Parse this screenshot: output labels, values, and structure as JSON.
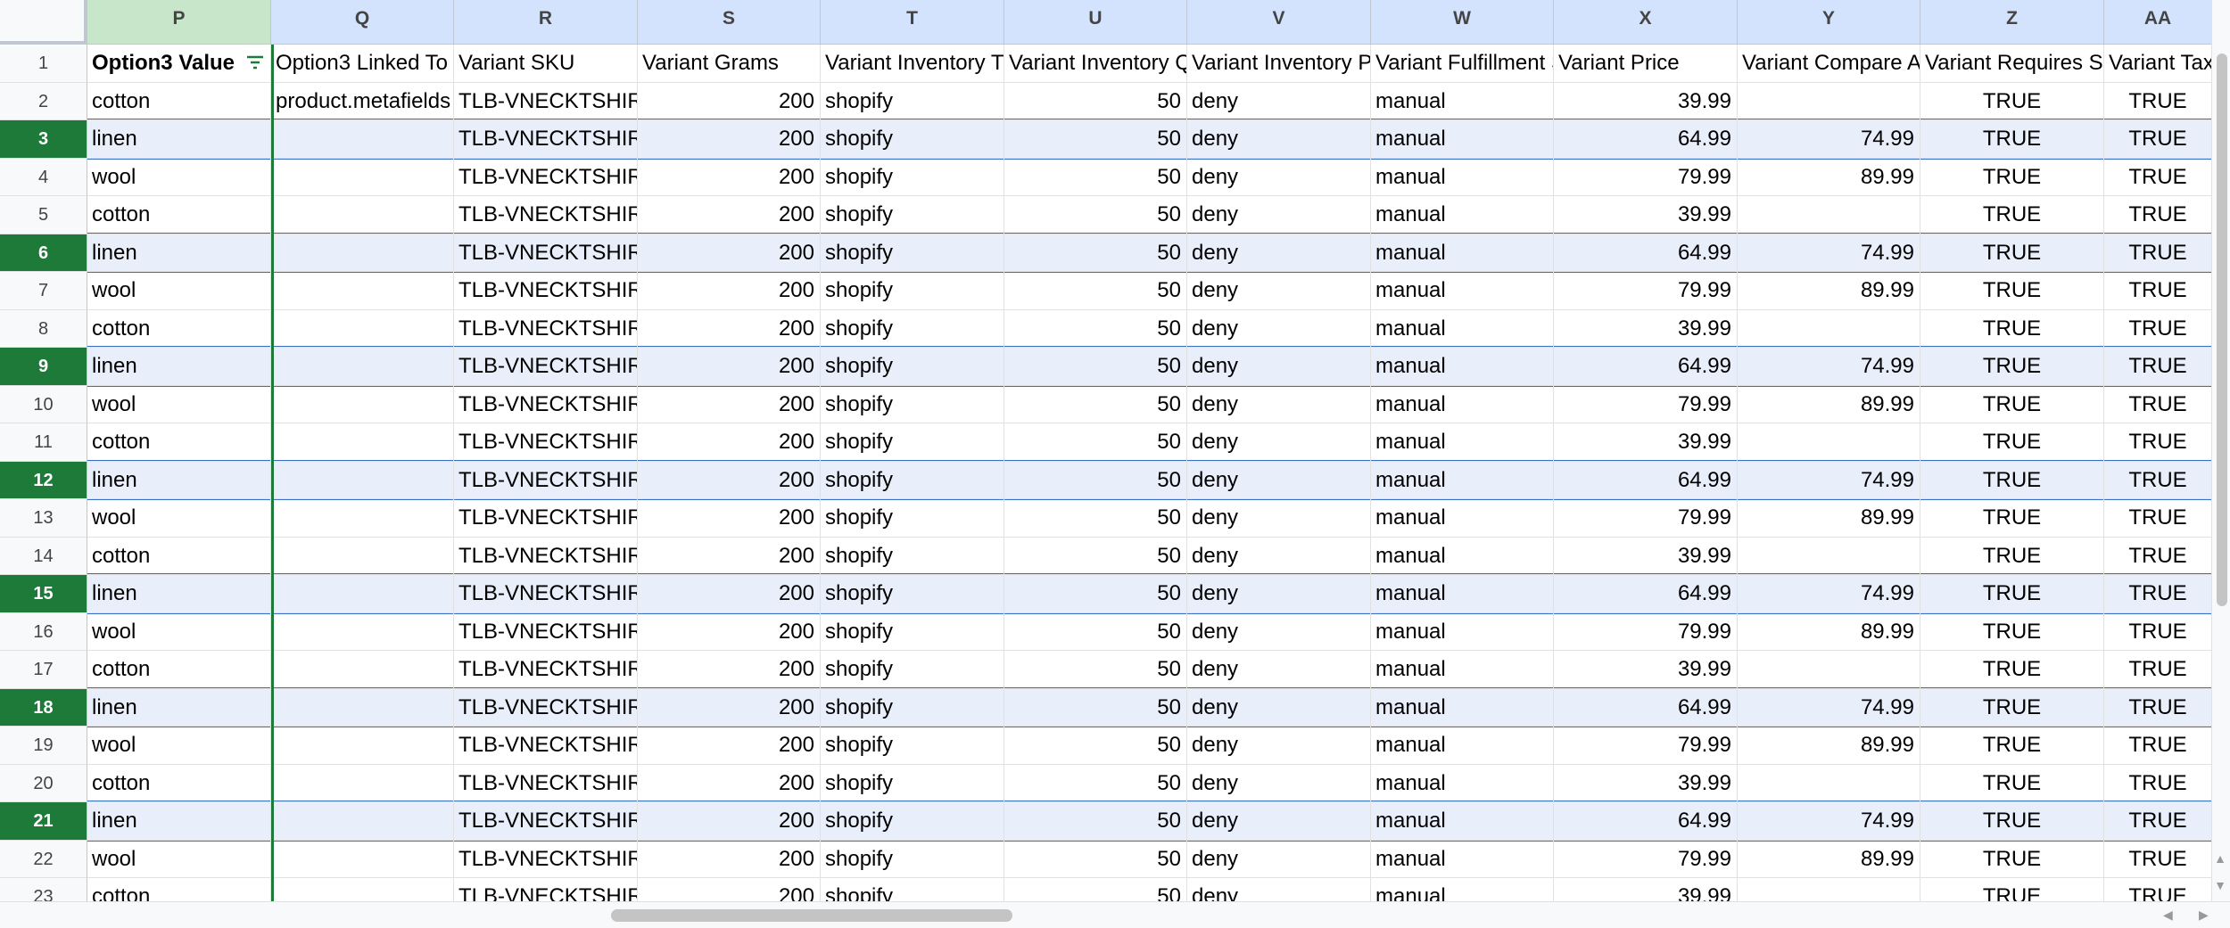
{
  "columns": [
    {
      "letter": "P",
      "header": "Option3 Value",
      "bold": true,
      "filter": true
    },
    {
      "letter": "Q",
      "header": "Option3 Linked To"
    },
    {
      "letter": "R",
      "header": "Variant SKU"
    },
    {
      "letter": "S",
      "header": "Variant Grams"
    },
    {
      "letter": "T",
      "header": "Variant Inventory Tracker"
    },
    {
      "letter": "U",
      "header": "Variant Inventory Qty"
    },
    {
      "letter": "V",
      "header": "Variant Inventory Policy"
    },
    {
      "letter": "W",
      "header": "Variant Fulfillment Service"
    },
    {
      "letter": "X",
      "header": "Variant Price"
    },
    {
      "letter": "Y",
      "header": "Variant Compare At Price"
    },
    {
      "letter": "Z",
      "header": "Variant Requires Shipping"
    },
    {
      "letter": "AA",
      "header": "Variant Taxable"
    }
  ],
  "rows": [
    {
      "num": "2",
      "cells": [
        "cotton",
        "product.metafields",
        "TLB-VNECKTSHIRT",
        "200",
        "shopify",
        "50",
        "deny",
        "manual",
        "39.99",
        "",
        "TRUE",
        "TRUE"
      ]
    },
    {
      "num": "3",
      "cells": [
        "linen",
        "",
        "TLB-VNECKTSHIRT",
        "200",
        "shopify",
        "50",
        "deny",
        "manual",
        "64.99",
        "74.99",
        "TRUE",
        "TRUE"
      ]
    },
    {
      "num": "4",
      "cells": [
        "wool",
        "",
        "TLB-VNECKTSHIRT",
        "200",
        "shopify",
        "50",
        "deny",
        "manual",
        "79.99",
        "89.99",
        "TRUE",
        "TRUE"
      ]
    },
    {
      "num": "5",
      "cells": [
        "cotton",
        "",
        "TLB-VNECKTSHIRT",
        "200",
        "shopify",
        "50",
        "deny",
        "manual",
        "39.99",
        "",
        "TRUE",
        "TRUE"
      ]
    },
    {
      "num": "6",
      "cells": [
        "linen",
        "",
        "TLB-VNECKTSHIRT",
        "200",
        "shopify",
        "50",
        "deny",
        "manual",
        "64.99",
        "74.99",
        "TRUE",
        "TRUE"
      ]
    },
    {
      "num": "7",
      "cells": [
        "wool",
        "",
        "TLB-VNECKTSHIRT",
        "200",
        "shopify",
        "50",
        "deny",
        "manual",
        "79.99",
        "89.99",
        "TRUE",
        "TRUE"
      ]
    },
    {
      "num": "8",
      "cells": [
        "cotton",
        "",
        "TLB-VNECKTSHIRT",
        "200",
        "shopify",
        "50",
        "deny",
        "manual",
        "39.99",
        "",
        "TRUE",
        "TRUE"
      ]
    },
    {
      "num": "9",
      "cells": [
        "linen",
        "",
        "TLB-VNECKTSHIRT",
        "200",
        "shopify",
        "50",
        "deny",
        "manual",
        "64.99",
        "74.99",
        "TRUE",
        "TRUE"
      ]
    },
    {
      "num": "10",
      "cells": [
        "wool",
        "",
        "TLB-VNECKTSHIRT",
        "200",
        "shopify",
        "50",
        "deny",
        "manual",
        "79.99",
        "89.99",
        "TRUE",
        "TRUE"
      ]
    },
    {
      "num": "11",
      "cells": [
        "cotton",
        "",
        "TLB-VNECKTSHIRT",
        "200",
        "shopify",
        "50",
        "deny",
        "manual",
        "39.99",
        "",
        "TRUE",
        "TRUE"
      ]
    },
    {
      "num": "12",
      "cells": [
        "linen",
        "",
        "TLB-VNECKTSHIRT",
        "200",
        "shopify",
        "50",
        "deny",
        "manual",
        "64.99",
        "74.99",
        "TRUE",
        "TRUE"
      ]
    },
    {
      "num": "13",
      "cells": [
        "wool",
        "",
        "TLB-VNECKTSHIRT",
        "200",
        "shopify",
        "50",
        "deny",
        "manual",
        "79.99",
        "89.99",
        "TRUE",
        "TRUE"
      ]
    },
    {
      "num": "14",
      "cells": [
        "cotton",
        "",
        "TLB-VNECKTSHIRT",
        "200",
        "shopify",
        "50",
        "deny",
        "manual",
        "39.99",
        "",
        "TRUE",
        "TRUE"
      ]
    },
    {
      "num": "15",
      "cells": [
        "linen",
        "",
        "TLB-VNECKTSHIRT",
        "200",
        "shopify",
        "50",
        "deny",
        "manual",
        "64.99",
        "74.99",
        "TRUE",
        "TRUE"
      ]
    },
    {
      "num": "16",
      "cells": [
        "wool",
        "",
        "TLB-VNECKTSHIRT",
        "200",
        "shopify",
        "50",
        "deny",
        "manual",
        "79.99",
        "89.99",
        "TRUE",
        "TRUE"
      ]
    },
    {
      "num": "17",
      "cells": [
        "cotton",
        "",
        "TLB-VNECKTSHIRT",
        "200",
        "shopify",
        "50",
        "deny",
        "manual",
        "39.99",
        "",
        "TRUE",
        "TRUE"
      ]
    },
    {
      "num": "18",
      "cells": [
        "linen",
        "",
        "TLB-VNECKTSHIRT",
        "200",
        "shopify",
        "50",
        "deny",
        "manual",
        "64.99",
        "74.99",
        "TRUE",
        "TRUE"
      ]
    },
    {
      "num": "19",
      "cells": [
        "wool",
        "",
        "TLB-VNECKTSHIRT",
        "200",
        "shopify",
        "50",
        "deny",
        "manual",
        "79.99",
        "89.99",
        "TRUE",
        "TRUE"
      ]
    },
    {
      "num": "20",
      "cells": [
        "cotton",
        "",
        "TLB-VNECKTSHIRT",
        "200",
        "shopify",
        "50",
        "deny",
        "manual",
        "39.99",
        "",
        "TRUE",
        "TRUE"
      ]
    },
    {
      "num": "21",
      "cells": [
        "linen",
        "",
        "TLB-VNECKTSHIRT",
        "200",
        "shopify",
        "50",
        "deny",
        "manual",
        "64.99",
        "74.99",
        "TRUE",
        "TRUE"
      ]
    },
    {
      "num": "22",
      "cells": [
        "wool",
        "",
        "TLB-VNECKTSHIRT",
        "200",
        "shopify",
        "50",
        "deny",
        "manual",
        "79.99",
        "89.99",
        "TRUE",
        "TRUE"
      ]
    },
    {
      "num": "23",
      "cells": [
        "cotton",
        "",
        "TLB-VNECKTSHIRT",
        "200",
        "shopify",
        "50",
        "deny",
        "manual",
        "39.99",
        "",
        "TRUE",
        "TRUE"
      ]
    }
  ],
  "selected_rows": [
    "3",
    "6",
    "9",
    "12",
    "15",
    "18",
    "21"
  ],
  "numeric_columns": [
    "S",
    "U",
    "X",
    "Y"
  ],
  "center_columns": [
    "Z",
    "AA"
  ],
  "colors": {
    "selected_row_header": "#1e7a39",
    "row_highlight": "#e8eefa",
    "row_highlight_border": "#3b6fc6",
    "column_header_bg": "#d3e3fd",
    "active_column_header": "#c8e6c9"
  }
}
